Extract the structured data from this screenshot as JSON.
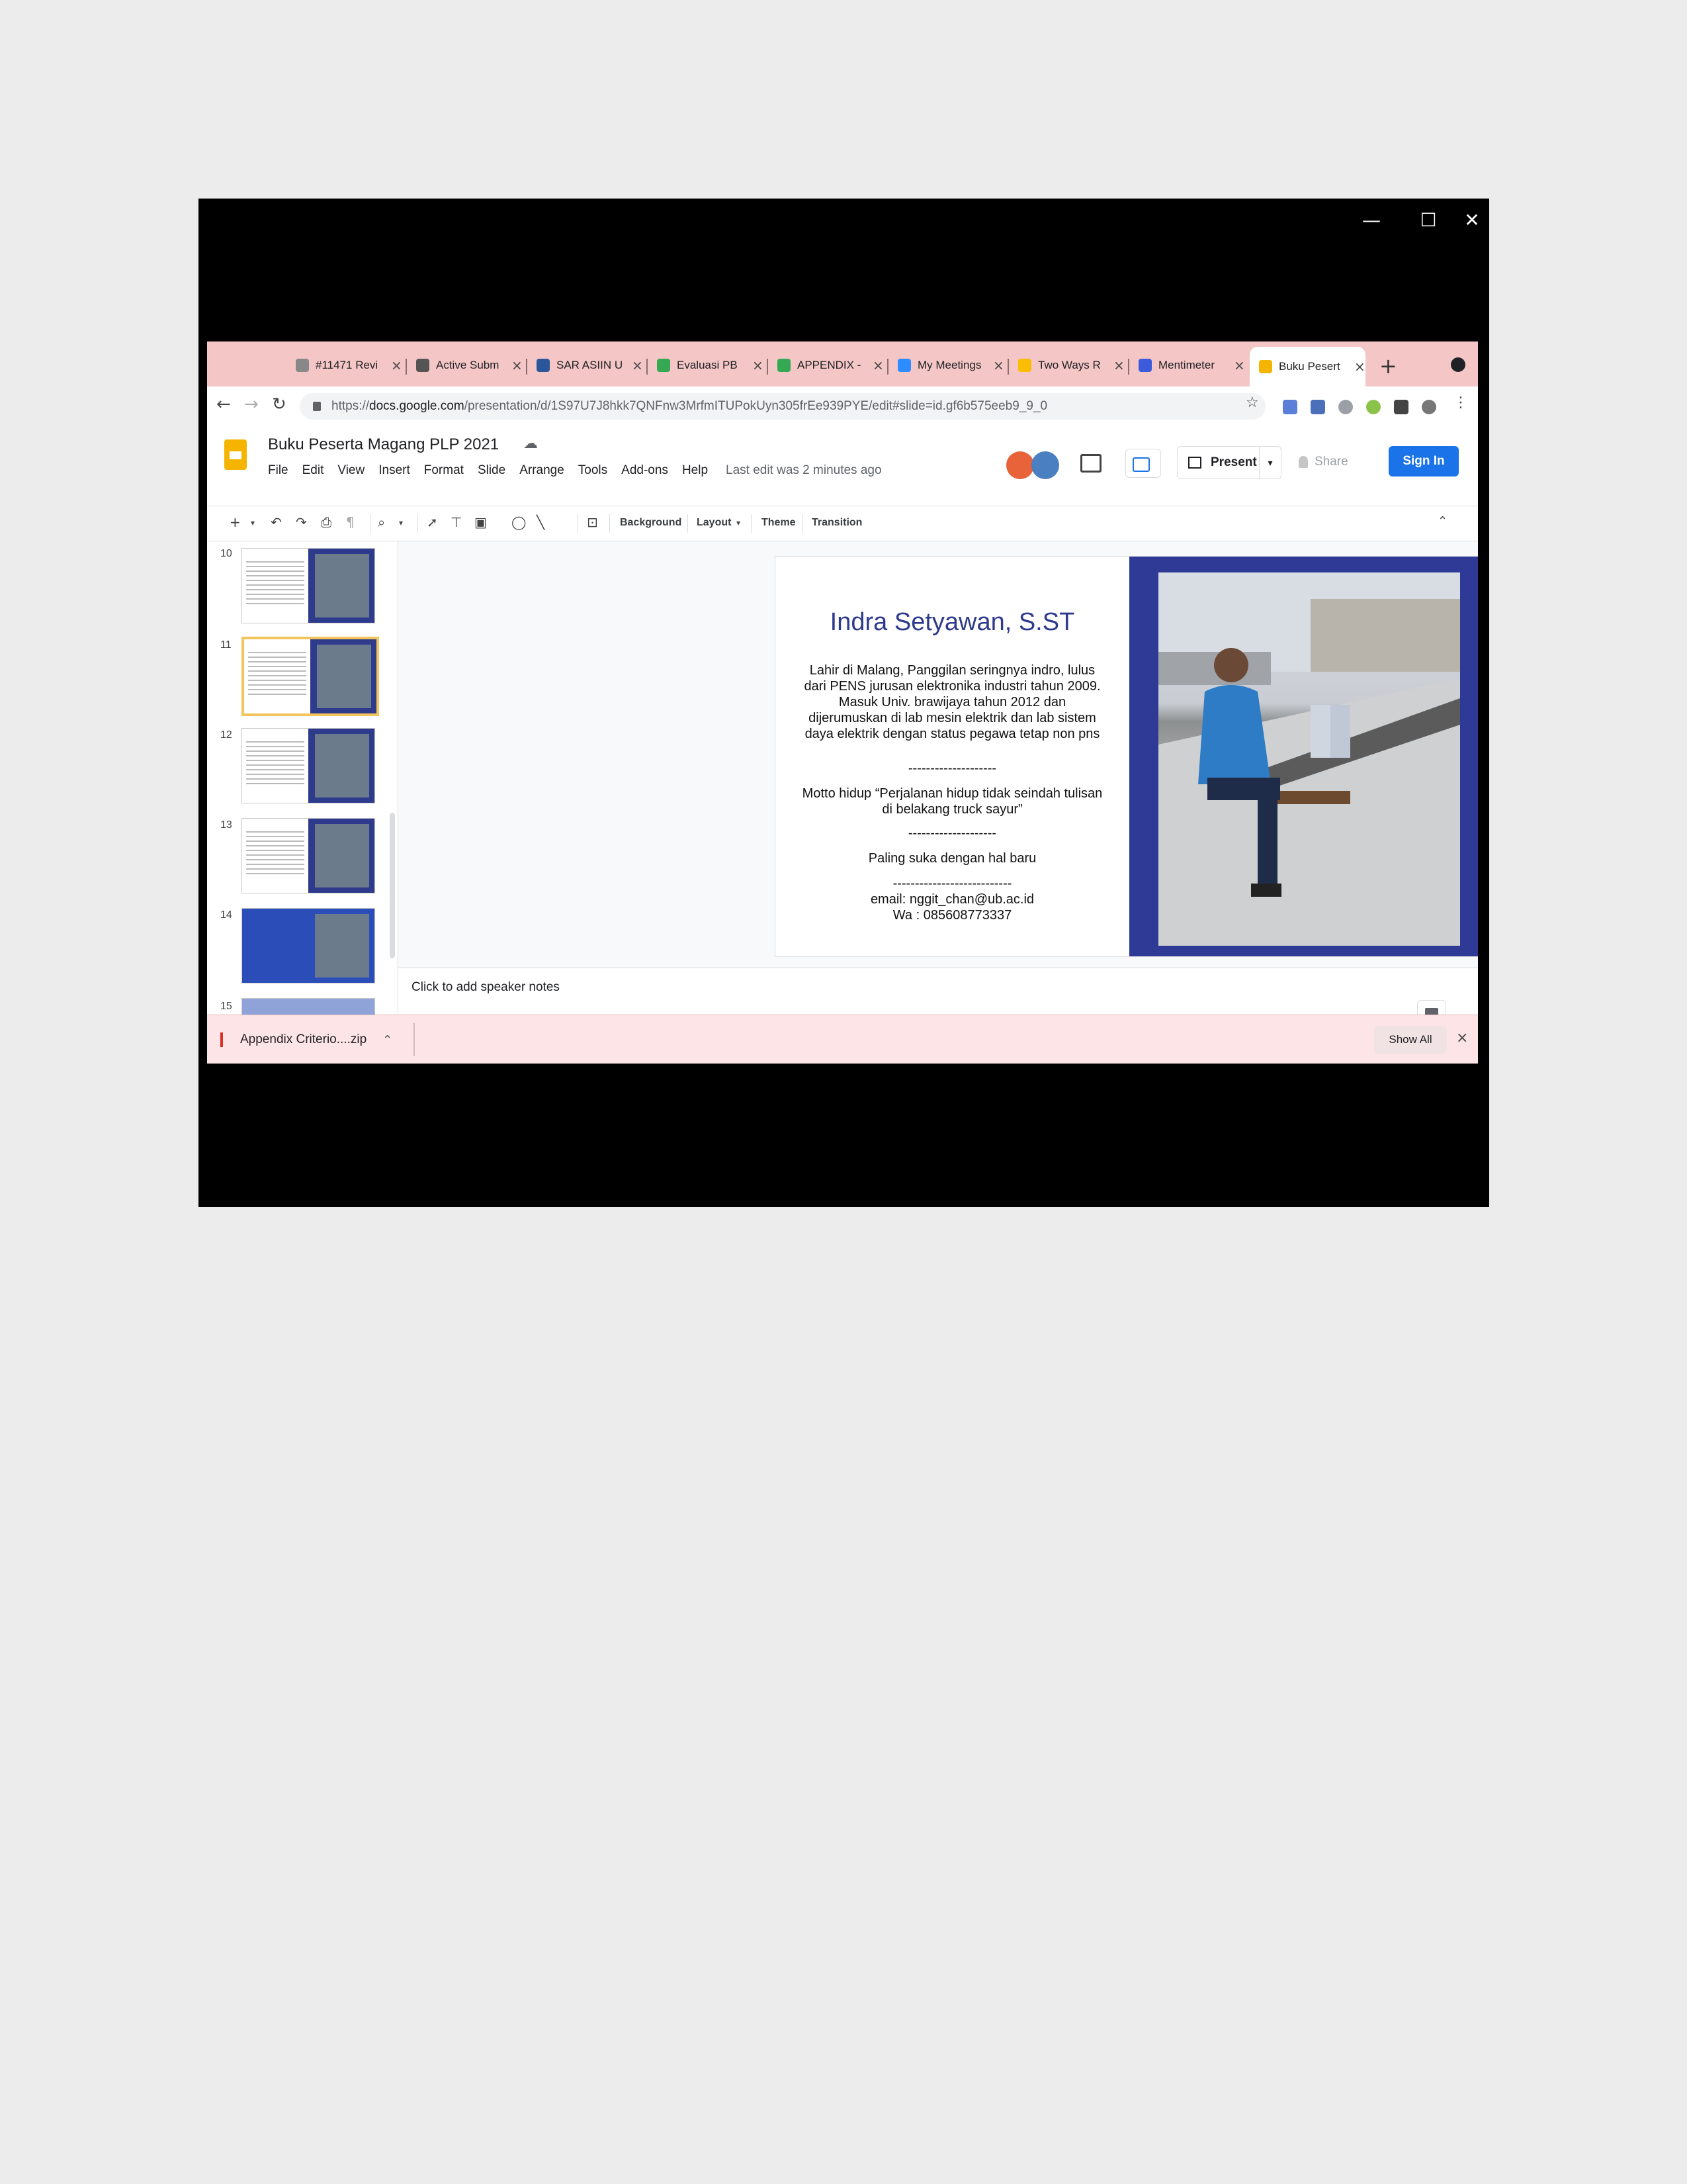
{
  "window": {
    "minimize": "—",
    "maximize": "☐",
    "close": "✕"
  },
  "tabs": [
    {
      "label": "#11471 Revi",
      "color": "#888888"
    },
    {
      "label": "Active Subm",
      "color": "#555555"
    },
    {
      "label": "SAR ASIIN U",
      "color": "#2b579a"
    },
    {
      "label": "Evaluasi PB",
      "color": "#34a853"
    },
    {
      "label": "APPENDIX -",
      "color": "#34a853"
    },
    {
      "label": "My Meetings",
      "color": "#2d8cff"
    },
    {
      "label": "Two Ways R",
      "color": "#fbbc04"
    },
    {
      "label": "Mentimeter",
      "color": "#3b5bdb"
    },
    {
      "label": "Buku Pesert",
      "color": "#f4b400"
    }
  ],
  "tab_close": "×",
  "new_tab": "+",
  "address": {
    "scheme": "https://",
    "host": "docs.google.com",
    "path": "/presentation/d/1S97U7J8hkk7QNFnw3MrfmITUPokUyn305frEe939PYE/edit#slide=id.gf6b575eeb9_9_0"
  },
  "app": {
    "title": "Buku Peserta Magang PLP 2021",
    "menu": [
      "File",
      "Edit",
      "View",
      "Insert",
      "Format",
      "Slide",
      "Arrange",
      "Tools",
      "Add-ons",
      "Help"
    ],
    "last_edit": "Last edit was 2 minutes ago",
    "present": "Present",
    "share": "Share",
    "sign_in": "Sign In"
  },
  "toolbar": {
    "background": "Background",
    "layout": "Layout",
    "theme": "Theme",
    "transition": "Transition"
  },
  "filmstrip": {
    "numbers": [
      "10",
      "11",
      "12",
      "13",
      "14",
      "15"
    ],
    "selected": "11"
  },
  "slide": {
    "name": "Indra Setyawan, S.ST",
    "bio": "Lahir di Malang, Panggilan seringnya indro, lulus dari PENS jurusan elektronika industri tahun 2009. Masuk Univ. brawijaya tahun 2012 dan dijerumuskan di lab mesin elektrik dan lab sistem daya elektrik dengan status pegawa tetap non pns",
    "divider1": "--------------------",
    "motto": "Motto hidup “Perjalanan hidup tidak seindah tulisan di belakang truck sayur”",
    "divider2": "--------------------",
    "likes": "Paling suka dengan hal baru",
    "divider3": "---------------------------",
    "email": "email: nggit_chan@ub.ac.id",
    "wa": "Wa : 085608773337",
    "accent_color": "#2f3a96"
  },
  "notes": {
    "placeholder": "Click to add speaker notes"
  },
  "download": {
    "file": "Appendix Criterio....zip",
    "show_all": "Show All",
    "close": "×"
  }
}
